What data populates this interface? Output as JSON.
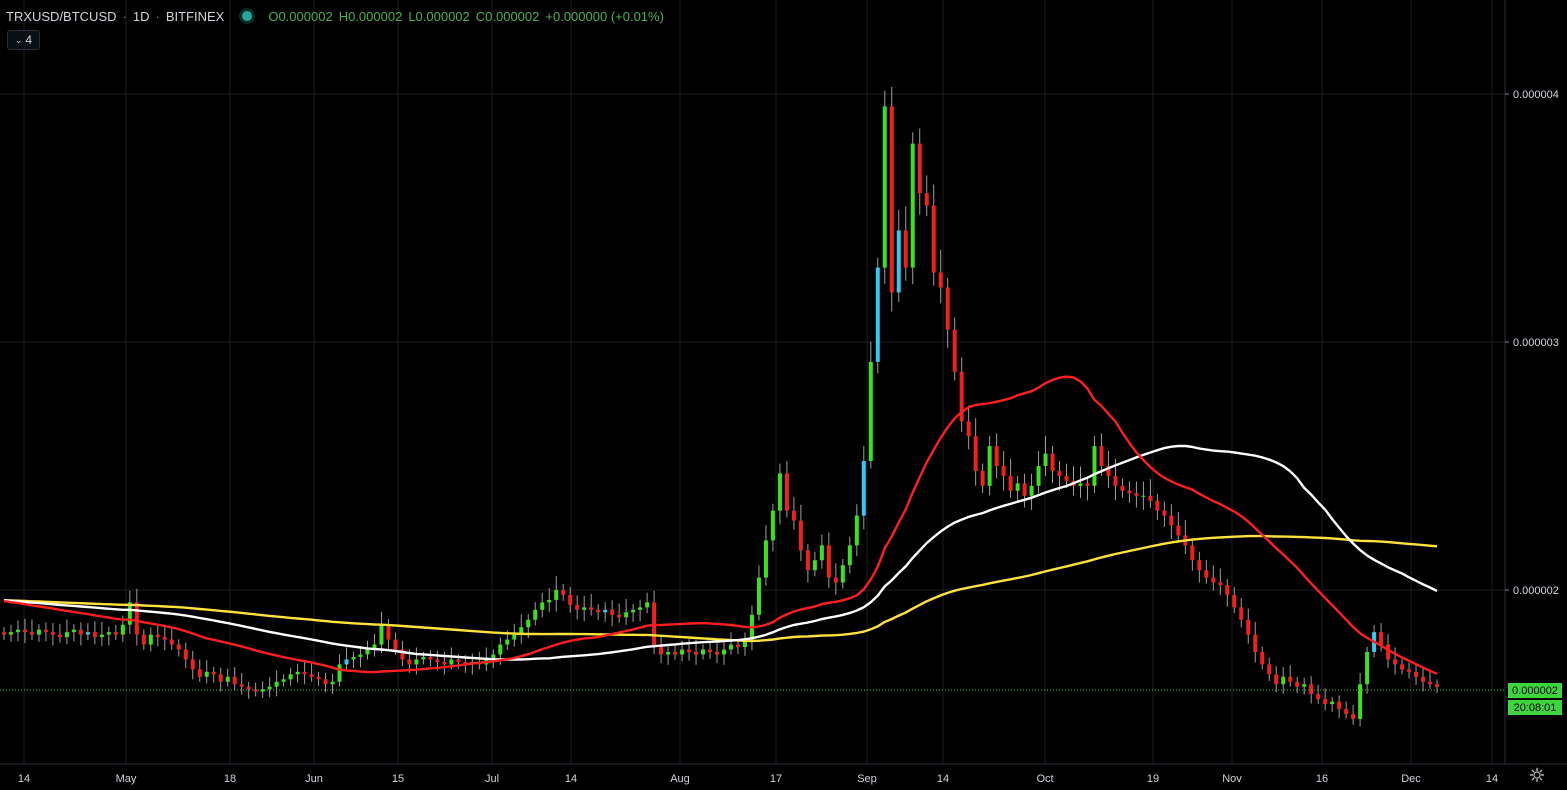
{
  "header": {
    "symbol": "TRXUSD/BTCUSD",
    "interval": "1D",
    "exchange": "BITFINEX",
    "open": "O0.000002",
    "high": "H0.000002",
    "low": "L0.000002",
    "close": "C0.000002",
    "change": "+0.000000 (+0.01%)"
  },
  "indicators_button": {
    "count": "4"
  },
  "price_axis": {
    "last_price_label": "0.000002",
    "countdown": "20:08:01"
  },
  "colors": {
    "background": "#000000",
    "up_candle": "#3be11f",
    "down_candle": "#f21f1f",
    "up_candle_alt": "#35c8f5",
    "ma_red": "#ff1f1f",
    "ma_white": "#ffffff",
    "ma_yellow": "#ffe23b",
    "grid": "#1e1e24",
    "last_price_tag": "#3cd63c"
  },
  "chart_data": {
    "type": "candlestick",
    "title": "",
    "y_ticks": [
      "0.000004",
      "0.000003",
      "0.000002"
    ],
    "x_ticks": [
      "14",
      "May",
      "18",
      "Jun",
      "15",
      "Jul",
      "14",
      "Aug",
      "17",
      "Sep",
      "14",
      "Oct",
      "19",
      "Nov",
      "16",
      "Dec",
      "14"
    ],
    "ylim": [
      1.2e-06,
      4.3e-06
    ],
    "grid": true,
    "candles_close": [
      1.82e-06,
      1.83e-06,
      1.84e-06,
      1.83e-06,
      1.82e-06,
      1.84e-06,
      1.83e-06,
      1.82e-06,
      1.81e-06,
      1.83e-06,
      1.84e-06,
      1.82e-06,
      1.83e-06,
      1.81e-06,
      1.82e-06,
      1.83e-06,
      1.82e-06,
      1.86e-06,
      1.95e-06,
      1.82e-06,
      1.78e-06,
      1.82e-06,
      1.81e-06,
      1.8e-06,
      1.78e-06,
      1.76e-06,
      1.72e-06,
      1.68e-06,
      1.65e-06,
      1.67e-06,
      1.66e-06,
      1.63e-06,
      1.65e-06,
      1.62e-06,
      1.61e-06,
      1.6e-06,
      1.59e-06,
      1.6e-06,
      1.61e-06,
      1.63e-06,
      1.64e-06,
      1.66e-06,
      1.67e-06,
      1.66e-06,
      1.65e-06,
      1.64e-06,
      1.62e-06,
      1.63e-06,
      1.7e-06,
      1.72e-06,
      1.73e-06,
      1.74e-06,
      1.76e-06,
      1.78e-06,
      1.86e-06,
      1.8e-06,
      1.76e-06,
      1.72e-06,
      1.7e-06,
      1.72e-06,
      1.73e-06,
      1.72e-06,
      1.71e-06,
      1.7e-06,
      1.72e-06,
      1.71e-06,
      1.7e-06,
      1.71e-06,
      1.7e-06,
      1.72e-06,
      1.74e-06,
      1.78e-06,
      1.8e-06,
      1.82e-06,
      1.85e-06,
      1.88e-06,
      1.92e-06,
      1.95e-06,
      1.96e-06,
      2e-06,
      1.98e-06,
      1.94e-06,
      1.92e-06,
      1.93e-06,
      1.92e-06,
      1.91e-06,
      1.92e-06,
      1.9e-06,
      1.89e-06,
      1.91e-06,
      1.92e-06,
      1.93e-06,
      1.95e-06,
      1.77e-06,
      1.74e-06,
      1.75e-06,
      1.74e-06,
      1.76e-06,
      1.75e-06,
      1.74e-06,
      1.76e-06,
      1.75e-06,
      1.74e-06,
      1.76e-06,
      1.78e-06,
      1.77e-06,
      1.8e-06,
      1.9e-06,
      2.05e-06,
      2.2e-06,
      2.32e-06,
      2.47e-06,
      2.32e-06,
      2.28e-06,
      2.16e-06,
      2.08e-06,
      2.12e-06,
      2.18e-06,
      2.05e-06,
      2.03e-06,
      2.1e-06,
      2.18e-06,
      2.3e-06,
      2.52e-06,
      2.92e-06,
      3.3e-06,
      3.95e-06,
      3.2e-06,
      3.45e-06,
      3.3e-06,
      3.8e-06,
      3.6e-06,
      3.55e-06,
      3.28e-06,
      3.22e-06,
      3.05e-06,
      2.88e-06,
      2.68e-06,
      2.62e-06,
      2.48e-06,
      2.42e-06,
      2.58e-06,
      2.5e-06,
      2.46e-06,
      2.4e-06,
      2.43e-06,
      2.38e-06,
      2.42e-06,
      2.5e-06,
      2.55e-06,
      2.48e-06,
      2.46e-06,
      2.44e-06,
      2.42e-06,
      2.43e-06,
      2.42e-06,
      2.58e-06,
      2.5e-06,
      2.46e-06,
      2.42e-06,
      2.4e-06,
      2.39e-06,
      2.38e-06,
      2.38e-06,
      2.36e-06,
      2.32e-06,
      2.3e-06,
      2.26e-06,
      2.22e-06,
      2.18e-06,
      2.12e-06,
      2.08e-06,
      2.05e-06,
      2.03e-06,
      2.02e-06,
      1.98e-06,
      1.93e-06,
      1.88e-06,
      1.82e-06,
      1.75e-06,
      1.7e-06,
      1.66e-06,
      1.62e-06,
      1.65e-06,
      1.63e-06,
      1.61e-06,
      1.62e-06,
      1.58e-06,
      1.56e-06,
      1.54e-06,
      1.55e-06,
      1.52e-06,
      1.5e-06,
      1.48e-06,
      1.62e-06,
      1.75e-06,
      1.83e-06,
      1.78e-06,
      1.72e-06,
      1.7e-06,
      1.68e-06,
      1.67e-06,
      1.65e-06,
      1.63e-06,
      1.62e-06,
      1.61e-06
    ],
    "ma_red": "50-day moving average (red)",
    "ma_white": "100-day moving average (white)",
    "ma_yellow": "200-day moving average (yellow)"
  }
}
